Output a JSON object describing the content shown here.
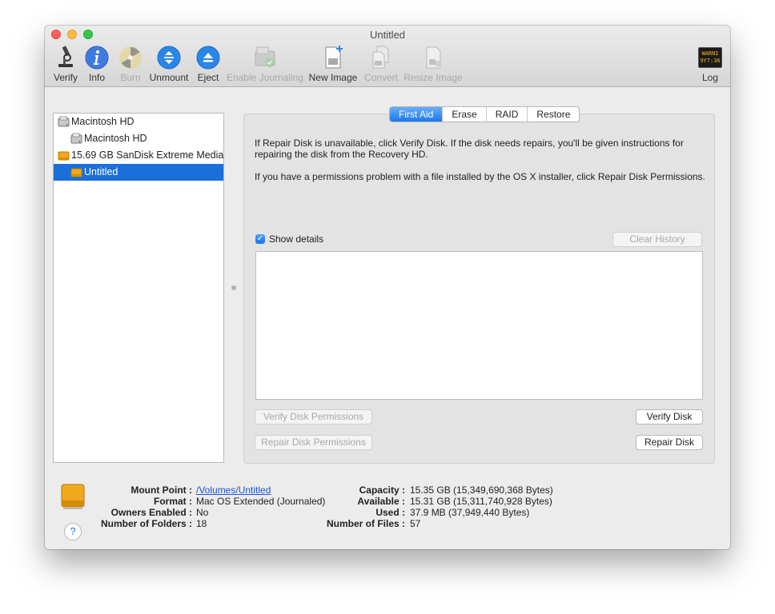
{
  "window": {
    "title": "Untitled"
  },
  "toolbar": {
    "verify": "Verify",
    "info": "Info",
    "burn": "Burn",
    "unmount": "Unmount",
    "eject": "Eject",
    "enable_journaling": "Enable Journaling",
    "new_image": "New Image",
    "convert": "Convert",
    "resize_image": "Resize Image",
    "log": "Log",
    "log_display_line1": "WARNI",
    "log_display_line2": "9Y7:36"
  },
  "sidebar": {
    "items": [
      {
        "label": "Macintosh HD"
      },
      {
        "label": "Macintosh HD"
      },
      {
        "label": "15.69 GB SanDisk Extreme Media"
      },
      {
        "label": "Untitled"
      }
    ]
  },
  "tabs": [
    "First Aid",
    "Erase",
    "RAID",
    "Restore"
  ],
  "first_aid": {
    "para1": "If Repair Disk is unavailable, click Verify Disk. If the disk needs repairs, you'll be given instructions for repairing the disk from the Recovery HD.",
    "para2": "If you have a permissions problem with a file installed by the OS X installer, click Repair Disk Permissions.",
    "show_details": "Show details",
    "clear_history": "Clear History",
    "verify_permissions": "Verify Disk Permissions",
    "repair_permissions": "Repair Disk Permissions",
    "verify_disk": "Verify Disk",
    "repair_disk": "Repair Disk"
  },
  "info": {
    "mount_point_label": "Mount Point :",
    "mount_point": "/Volumes/Untitled",
    "format_label": "Format :",
    "format": "Mac OS Extended (Journaled)",
    "owners_label": "Owners Enabled :",
    "owners": "No",
    "folders_label": "Number of Folders :",
    "folders": "18",
    "capacity_label": "Capacity :",
    "capacity": "15.35 GB (15,349,690,368 Bytes)",
    "available_label": "Available :",
    "available": "15.31 GB (15,311,740,928 Bytes)",
    "used_label": "Used :",
    "used": "37.9 MB (37,949,440 Bytes)",
    "files_label": "Number of Files :",
    "files": "57",
    "help": "?"
  },
  "colors": {
    "accent": "#1a6fd8",
    "drive_orange": "#f0a81c"
  }
}
